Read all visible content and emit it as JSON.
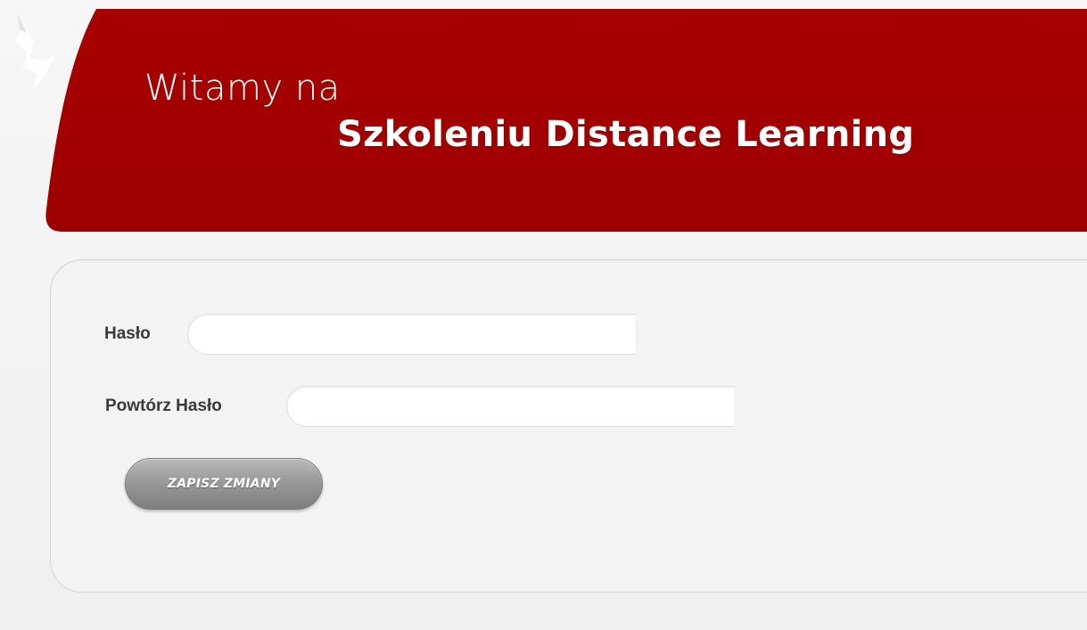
{
  "header": {
    "welcome_line1": "Witamy na",
    "welcome_line2": "Szkoleniu Distance Learning",
    "banner_color": "#a30000"
  },
  "form": {
    "password_label": "Hasło",
    "password_value": "",
    "repeat_password_label": "Powtórz Hasło",
    "repeat_password_value": "",
    "save_button_label": "ZAPISZ ZMIANY"
  }
}
